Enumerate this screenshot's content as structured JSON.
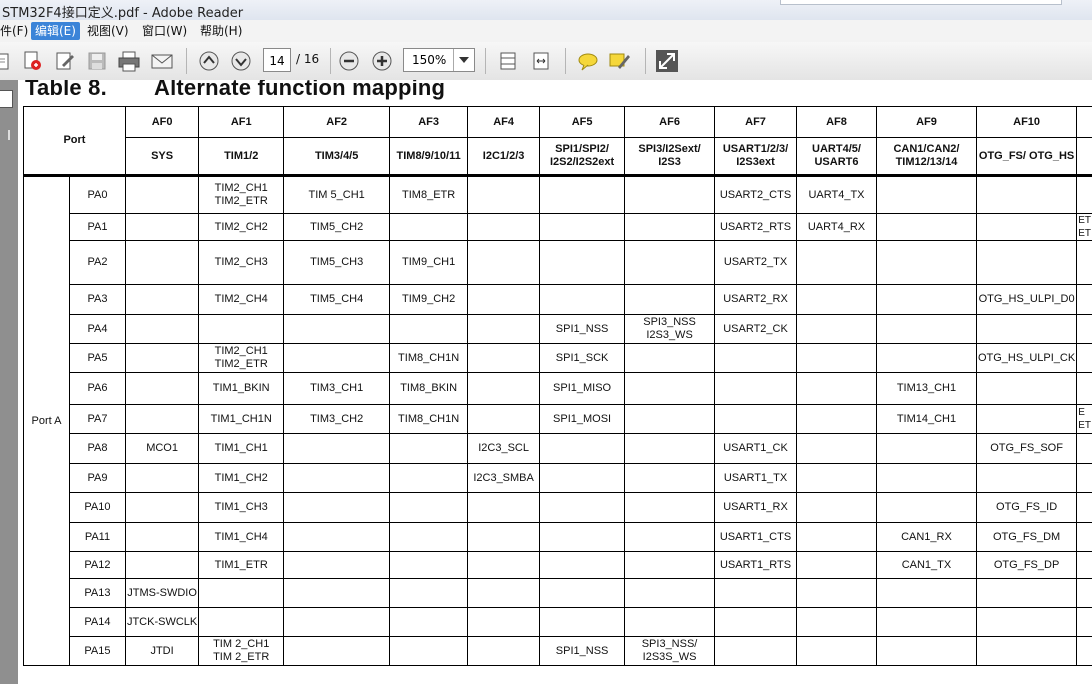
{
  "window": {
    "title": "STM32F4接口定义.pdf - Adobe Reader"
  },
  "menu": [
    {
      "label": "件(F)"
    },
    {
      "label": "编辑(E)"
    },
    {
      "label": "视图(V)"
    },
    {
      "label": "窗口(W)"
    },
    {
      "label": "帮助(H)"
    }
  ],
  "toolbar": {
    "page_current": "14",
    "page_total": "/ 16",
    "zoom": "150%",
    "icons": [
      "open-icon",
      "pdf-create-icon",
      "edit-icon",
      "save-icon",
      "print-icon",
      "email-icon",
      "previous-page-icon",
      "next-page-icon",
      "zoom-out-icon",
      "zoom-in-icon",
      "fit-page-icon",
      "fit-width-icon",
      "comment-icon",
      "sign-icon",
      "fullscreen-icon"
    ]
  },
  "document": {
    "table_no": "Table 8.",
    "table_name": "Alternate function mapping",
    "port_header": "Port",
    "af_headers": [
      "AF0",
      "AF1",
      "AF2",
      "AF3",
      "AF4",
      "AF5",
      "AF6",
      "AF7",
      "AF8",
      "AF9",
      "AF10"
    ],
    "af_groups": [
      "SYS",
      "TIM1/2",
      "TIM3/4/5",
      "TIM8/9/10/11",
      "I2C1/2/3",
      "SPI1/SPI2/\nI2S2/I2S2ext",
      "SPI3/I2Sext/\nI2S3",
      "USART1/2/3/\nI2S3ext",
      "UART4/5/\nUSART6",
      "CAN1/CAN2/\nTIM12/13/14",
      "OTG_FS/ OTG_HS"
    ],
    "port_label": "Port A",
    "rows": [
      {
        "pin": "PA0",
        "af": [
          "",
          "TIM2_CH1\nTIM2_ETR",
          "TIM 5_CH1",
          "TIM8_ETR",
          "",
          "",
          "",
          "USART2_CTS",
          "UART4_TX",
          "",
          ""
        ],
        "extra": ""
      },
      {
        "pin": "PA1",
        "af": [
          "",
          "TIM2_CH2",
          "TIM5_CH2",
          "",
          "",
          "",
          "",
          "USART2_RTS",
          "UART4_RX",
          "",
          ""
        ],
        "extra": "ET\nET"
      },
      {
        "pin": "PA2",
        "af": [
          "",
          "TIM2_CH3",
          "TIM5_CH3",
          "TIM9_CH1",
          "",
          "",
          "",
          "USART2_TX",
          "",
          "",
          ""
        ],
        "extra": ""
      },
      {
        "pin": "PA3",
        "af": [
          "",
          "TIM2_CH4",
          "TIM5_CH4",
          "TIM9_CH2",
          "",
          "",
          "",
          "USART2_RX",
          "",
          "",
          "OTG_HS_ULPI_D0"
        ],
        "extra": ""
      },
      {
        "pin": "PA4",
        "af": [
          "",
          "",
          "",
          "",
          "",
          "SPI1_NSS",
          "SPI3_NSS\nI2S3_WS",
          "USART2_CK",
          "",
          "",
          ""
        ],
        "extra": ""
      },
      {
        "pin": "PA5",
        "af": [
          "",
          "TIM2_CH1\nTIM2_ETR",
          "",
          "TIM8_CH1N",
          "",
          "SPI1_SCK",
          "",
          "",
          "",
          "",
          "OTG_HS_ULPI_CK"
        ],
        "extra": ""
      },
      {
        "pin": "PA6",
        "af": [
          "",
          "TIM1_BKIN",
          "TIM3_CH1",
          "TIM8_BKIN",
          "",
          "SPI1_MISO",
          "",
          "",
          "",
          "TIM13_CH1",
          ""
        ],
        "extra": ""
      },
      {
        "pin": "PA7",
        "af": [
          "",
          "TIM1_CH1N",
          "TIM3_CH2",
          "TIM8_CH1N",
          "",
          "SPI1_MOSI",
          "",
          "",
          "",
          "TIM14_CH1",
          ""
        ],
        "extra": "E\nET"
      },
      {
        "pin": "PA8",
        "af": [
          "MCO1",
          "TIM1_CH1",
          "",
          "",
          "I2C3_SCL",
          "",
          "",
          "USART1_CK",
          "",
          "",
          "OTG_FS_SOF"
        ],
        "extra": ""
      },
      {
        "pin": "PA9",
        "af": [
          "",
          "TIM1_CH2",
          "",
          "",
          "I2C3_SMBA",
          "",
          "",
          "USART1_TX",
          "",
          "",
          ""
        ],
        "extra": ""
      },
      {
        "pin": "PA10",
        "af": [
          "",
          "TIM1_CH3",
          "",
          "",
          "",
          "",
          "",
          "USART1_RX",
          "",
          "",
          "OTG_FS_ID"
        ],
        "extra": ""
      },
      {
        "pin": "PA11",
        "af": [
          "",
          "TIM1_CH4",
          "",
          "",
          "",
          "",
          "",
          "USART1_CTS",
          "",
          "CAN1_RX",
          "OTG_FS_DM"
        ],
        "extra": ""
      },
      {
        "pin": "PA12",
        "af": [
          "",
          "TIM1_ETR",
          "",
          "",
          "",
          "",
          "",
          "USART1_RTS",
          "",
          "CAN1_TX",
          "OTG_FS_DP"
        ],
        "extra": ""
      },
      {
        "pin": "PA13",
        "af": [
          "JTMS-SWDIO",
          "",
          "",
          "",
          "",
          "",
          "",
          "",
          "",
          "",
          ""
        ],
        "extra": ""
      },
      {
        "pin": "PA14",
        "af": [
          "JTCK-SWCLK",
          "",
          "",
          "",
          "",
          "",
          "",
          "",
          "",
          "",
          ""
        ],
        "extra": ""
      },
      {
        "pin": "PA15",
        "af": [
          "JTDI",
          "TIM 2_CH1\nTIM 2_ETR",
          "",
          "",
          "",
          "SPI1_NSS",
          "SPI3_NSS/\nI2S3S_WS",
          "",
          "",
          "",
          ""
        ],
        "extra": ""
      }
    ]
  }
}
